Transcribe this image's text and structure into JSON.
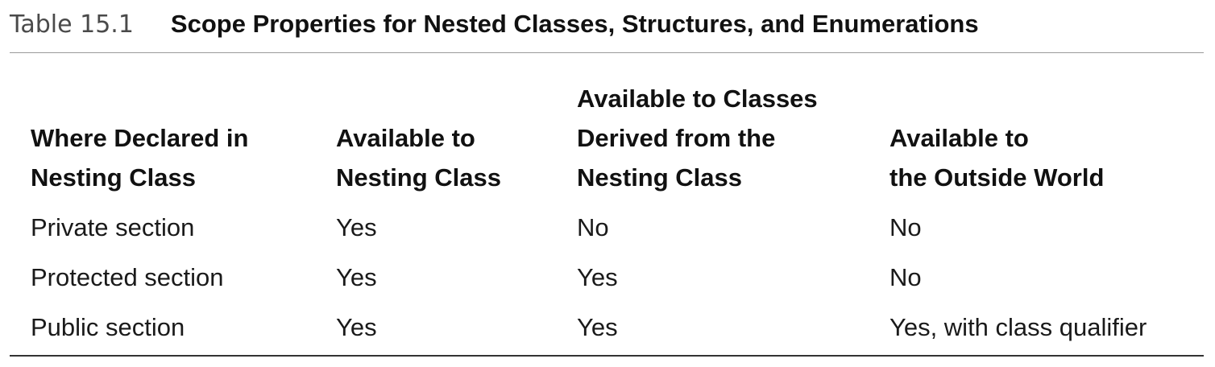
{
  "caption": {
    "label": "Table 15.1",
    "title": "Scope Properties for Nested Classes, Structures, and Enumerations"
  },
  "table": {
    "headers": [
      [
        "Where Declared in",
        "Nesting Class"
      ],
      [
        "Available to",
        "Nesting Class"
      ],
      [
        "Available to Classes",
        "Derived from the",
        "Nesting Class"
      ],
      [
        "Available to",
        "the Outside World"
      ]
    ],
    "rows": [
      [
        "Private section",
        "Yes",
        "No",
        "No"
      ],
      [
        "Protected section",
        "Yes",
        "Yes",
        "No"
      ],
      [
        "Public section",
        "Yes",
        "Yes",
        "Yes, with class qualifier"
      ]
    ]
  }
}
